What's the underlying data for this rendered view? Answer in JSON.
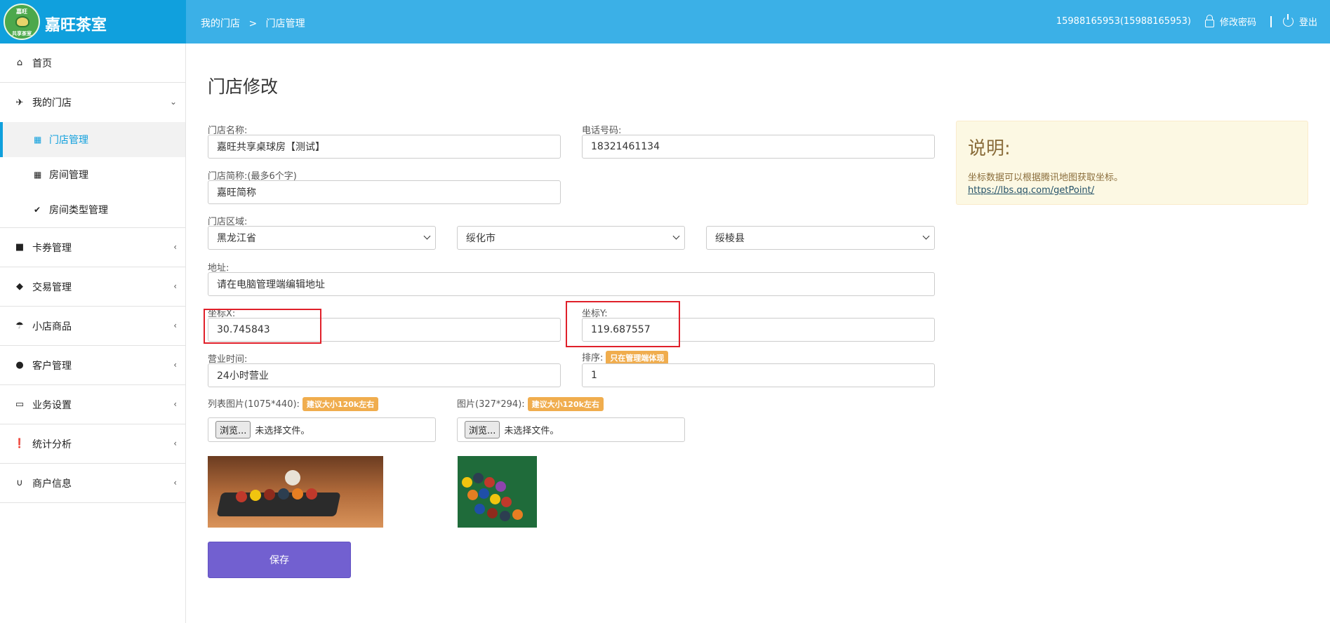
{
  "header": {
    "logo_top": "嘉旺",
    "logo_bottom": "共享茶室",
    "brand": "嘉旺茶室",
    "breadcrumb": [
      "我的门店",
      ">",
      "门店管理"
    ],
    "user": "15988165953(15988165953)",
    "change_password": "修改密码",
    "logout": "登出",
    "accent": "#3bb0e7"
  },
  "sidebar": {
    "items": [
      {
        "label": "首页",
        "icon": "home-icon"
      },
      {
        "label": "我的门店",
        "icon": "plane-icon",
        "expanded": true,
        "children": [
          {
            "label": "门店管理",
            "icon": "grid-icon",
            "active": true
          },
          {
            "label": "房间管理",
            "icon": "th-icon"
          },
          {
            "label": "房间类型管理",
            "icon": "check-icon"
          }
        ]
      },
      {
        "label": "卡券管理",
        "icon": "folder-icon"
      },
      {
        "label": "交易管理",
        "icon": "tags-icon"
      },
      {
        "label": "小店商品",
        "icon": "umbrella-icon"
      },
      {
        "label": "客户管理",
        "icon": "user-icon"
      },
      {
        "label": "业务设置",
        "icon": "inbox-icon"
      },
      {
        "label": "统计分析",
        "icon": "alert-icon"
      },
      {
        "label": "商户信息",
        "icon": "magnet-icon"
      }
    ]
  },
  "form": {
    "title": "门店修改",
    "store_name": {
      "label": "门店名称:",
      "value": "嘉旺共享桌球房【测试】"
    },
    "phone": {
      "label": "电话号码:",
      "value": "18321461134"
    },
    "short_name": {
      "label": "门店简称:(最多6个字)",
      "value": "嘉旺简称"
    },
    "region": {
      "label": "门店区域:",
      "province": "黑龙江省",
      "city": "绥化市",
      "county": "绥棱县"
    },
    "address": {
      "label": "地址:",
      "value": "请在电脑管理端编辑地址"
    },
    "coord_x": {
      "label": "坐标X:",
      "value": "30.745843"
    },
    "coord_y": {
      "label": "坐标Y:",
      "value": "119.687557"
    },
    "hours": {
      "label": "营业时间:",
      "value": "24小时营业"
    },
    "sort": {
      "label": "排序:",
      "badge": "只在管理端体现",
      "value": "1"
    },
    "list_image": {
      "label": "列表图片(1075*440):",
      "badge": "建议大小120k左右"
    },
    "image": {
      "label": "图片(327*294):",
      "badge": "建议大小120k左右"
    },
    "browse": "浏览...",
    "no_file": "未选择文件。",
    "save": "保存"
  },
  "note": {
    "title": "说明:",
    "text": "坐标数据可以根据腾讯地图获取坐标。",
    "link": "https://lbs.qq.com/getPoint/"
  }
}
